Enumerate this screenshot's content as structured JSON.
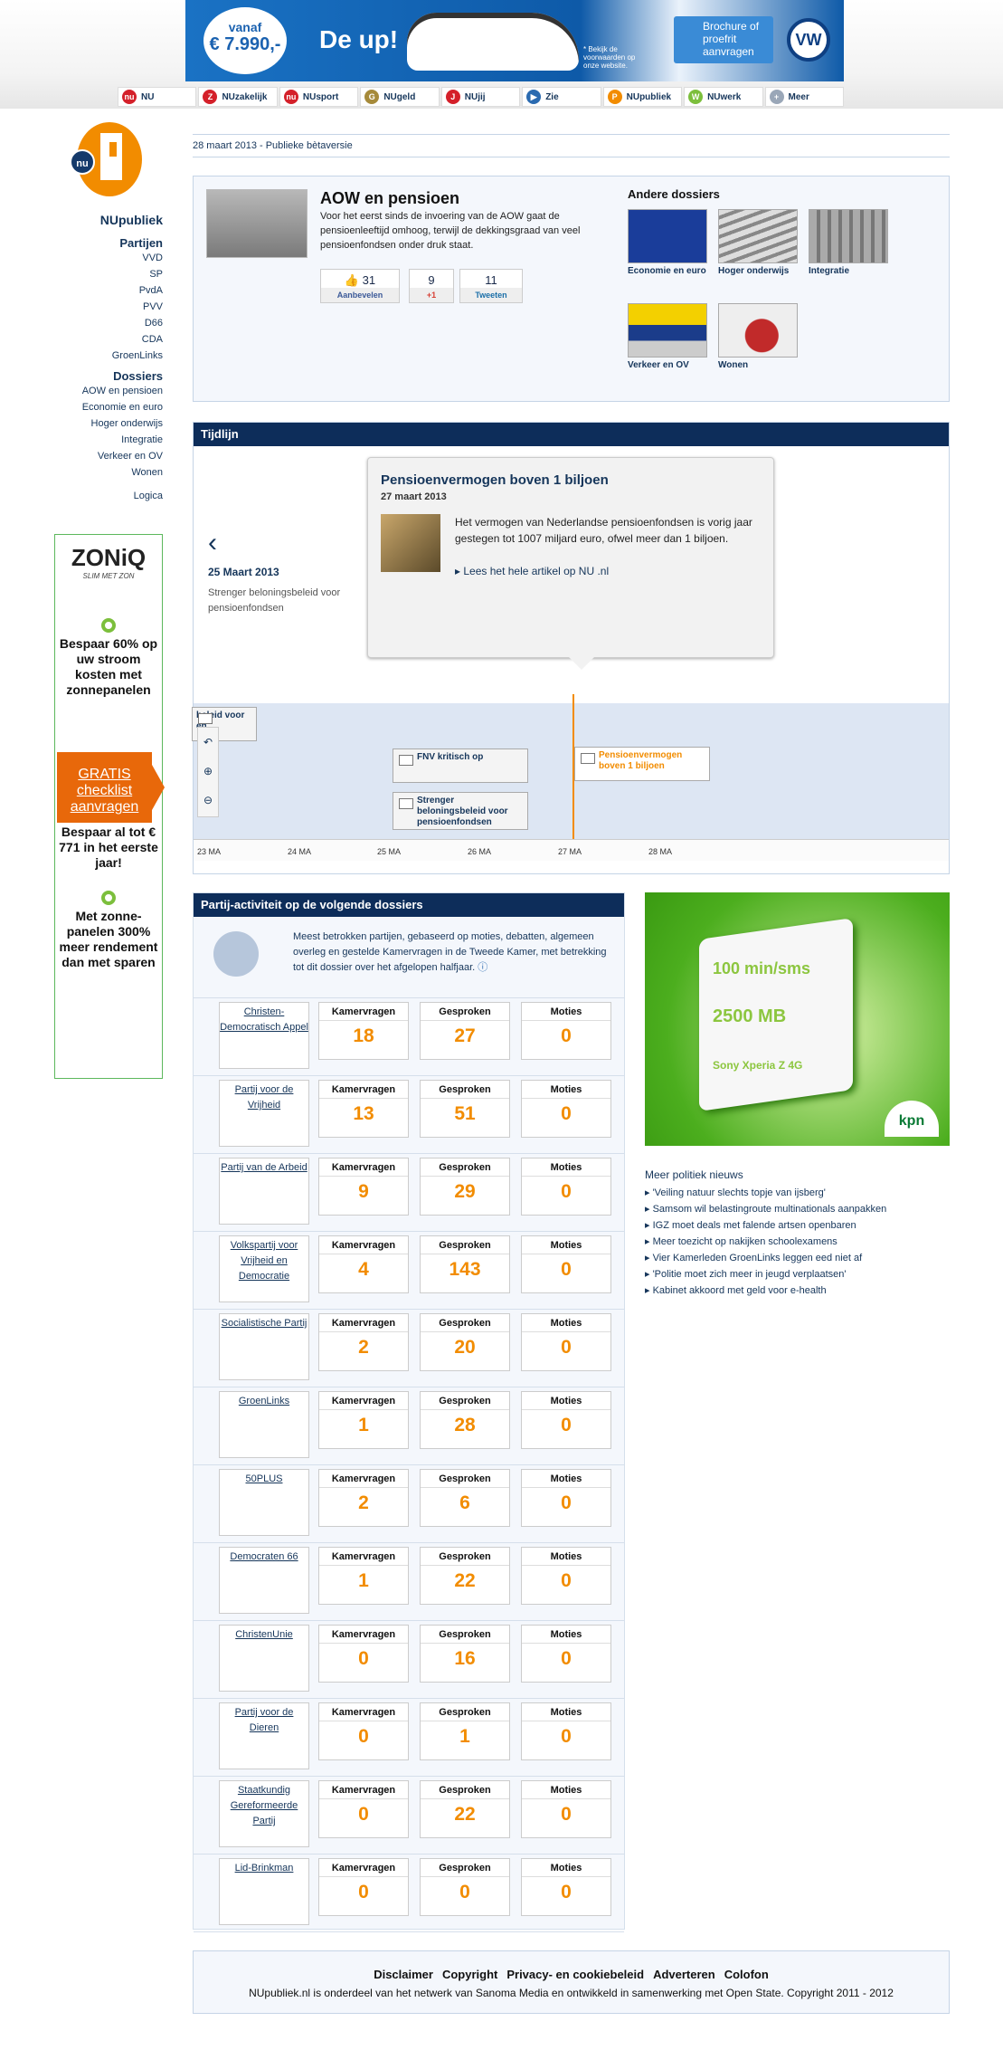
{
  "ad": {
    "price_small": "vanaf",
    "price": "€ 7.990,-",
    "headline": "De up!",
    "small_print": "* Bekijk de voorwaarden op onze website.",
    "cta": "Brochure of proefrit aanvragen",
    "brand": "VW"
  },
  "nav": [
    {
      "label": "NU",
      "color": "#d4202a",
      "icon": "nu"
    },
    {
      "label": "NUzakelijk",
      "color": "#d4202a",
      "icon": "Z"
    },
    {
      "label": "NUsport",
      "color": "#d4202a",
      "icon": "nu"
    },
    {
      "label": "NUgeld",
      "color": "#a68a3a",
      "icon": "G"
    },
    {
      "label": "NUjij",
      "color": "#d4202a",
      "icon": "J"
    },
    {
      "label": "Zie",
      "color": "#2a6ab0",
      "icon": "▶"
    },
    {
      "label": "NUpubliek",
      "color": "#f28c00",
      "icon": "P"
    },
    {
      "label": "NUwerk",
      "color": "#7cbf3c",
      "icon": "W"
    },
    {
      "label": "Meer",
      "color": "#9aa7b8",
      "icon": "+"
    }
  ],
  "sidebar": {
    "site_name": "NUpubliek",
    "logo_nu": "nu",
    "partijen_heading": "Partijen",
    "partijen": [
      "VVD",
      "SP",
      "PvdA",
      "PVV",
      "D66",
      "CDA",
      "GroenLinks"
    ],
    "dossiers_heading": "Dossiers",
    "dossiers": [
      "AOW en pensioen",
      "Economie en euro",
      "Hoger onderwijs",
      "Integratie",
      "Verkeer en OV",
      "Wonen"
    ],
    "logica": "Logica"
  },
  "zon": {
    "logo": "ZONiQ",
    "tagline": "SLIM MET ZON",
    "text1": "Bespaar 60% op uw stroom kosten met zonnepanelen",
    "button": "GRATIS checklist aanvragen",
    "text2": "Bespaar al tot € 771 in het eerste jaar!",
    "text3": "Met zonne-panelen 300% meer rendement dan met sparen"
  },
  "date_line": "28 maart 2013 - Publieke bètaversie",
  "dossier": {
    "title": "AOW en pensioen",
    "description": "Voor het eerst sinds de invoering van de AOW gaat de pensioenleeftijd omhoog, terwijl de dekkingsgraad van veel pensioenfondsen onder druk staat.",
    "likes": "31",
    "like_label": "Aanbevelen",
    "plus": "9",
    "plus_label": "+1",
    "tweets": "11",
    "tweet_label": "Tweeten",
    "other_heading": "Andere dossiers",
    "others": [
      "Economie en euro",
      "Hoger onderwijs",
      "Integratie",
      "Verkeer en OV",
      "Wonen"
    ]
  },
  "timeline": {
    "heading": "Tijdlijn",
    "popup_title": "Pensioenvermogen boven 1 biljoen",
    "popup_date": "27 maart 2013",
    "popup_text": "Het vermogen van Nederlandse pensioenfondsen is vorig jaar gestegen tot 1007 miljard euro, ofwel meer dan 1 biljoen.",
    "popup_link": "Lees het hele artikel op NU .nl",
    "prev_date": "25 Maart 2013",
    "prev_text": "Strenger beloningsbeleid voor pensioenfondsen",
    "events": [
      "beleid voor en",
      "FNV kritisch op",
      "Strenger beloningsbeleid voor pensioenfondsen",
      "Pensioenvermogen boven 1 biljoen"
    ],
    "ticks": [
      "23 MA",
      "24 MA",
      "25 MA",
      "26 MA",
      "27 MA",
      "28 MA"
    ]
  },
  "partij": {
    "heading": "Partij-activiteit op de volgende dossiers",
    "intro": "Meest betrokken partijen, gebaseerd op moties, debatten, algemeen overleg en gestelde Kamervragen in de Tweede Kamer, met betrekking tot dit dossier over het afgelopen halfjaar.",
    "col1": "Kamervragen",
    "col2": "Gesproken",
    "col3": "Moties",
    "rows": [
      {
        "name": "Christen-Democratisch Appel",
        "kv": "18",
        "g": "27",
        "m": "0"
      },
      {
        "name": "Partij voor de Vrijheid",
        "kv": "13",
        "g": "51",
        "m": "0"
      },
      {
        "name": "Partij van de Arbeid",
        "kv": "9",
        "g": "29",
        "m": "0"
      },
      {
        "name": "Volkspartij voor Vrijheid en Democratie",
        "kv": "4",
        "g": "143",
        "m": "0"
      },
      {
        "name": "Socialistische Partij",
        "kv": "2",
        "g": "20",
        "m": "0"
      },
      {
        "name": "GroenLinks",
        "kv": "1",
        "g": "28",
        "m": "0"
      },
      {
        "name": "50PLUS",
        "kv": "2",
        "g": "6",
        "m": "0"
      },
      {
        "name": "Democraten 66",
        "kv": "1",
        "g": "22",
        "m": "0"
      },
      {
        "name": "ChristenUnie",
        "kv": "0",
        "g": "16",
        "m": "0"
      },
      {
        "name": "Partij voor de Dieren",
        "kv": "0",
        "g": "1",
        "m": "0"
      },
      {
        "name": "Staatkundig Gereformeerde Partij",
        "kv": "0",
        "g": "22",
        "m": "0"
      },
      {
        "name": "Lid-Brinkman",
        "kv": "0",
        "g": "0",
        "m": "0"
      }
    ]
  },
  "kpn": {
    "line1": "100 min/sms",
    "line2": "2500 MB",
    "line3": "Sony Xperia Z 4G",
    "logo": "kpn"
  },
  "news": {
    "heading": "Meer politiek nieuws",
    "items": [
      "'Veiling natuur slechts topje van ijsberg'",
      "Samsom wil belastingroute multinationals aanpakken",
      "IGZ moet deals met falende artsen openbaren",
      "Meer toezicht op nakijken schoolexamens",
      "Vier Kamerleden GroenLinks leggen eed niet af",
      "'Politie moet zich meer in jeugd verplaatsen'",
      "Kabinet akkoord met geld voor e-health"
    ]
  },
  "footer": {
    "links": [
      "Disclaimer",
      "Copyright",
      "Privacy- en cookiebeleid",
      "Adverteren",
      "Colofon"
    ],
    "copy": "NUpubliek.nl is onderdeel van het netwerk van Sanoma Media en ontwikkeld in samenwerking met Open State. Copyright 2011 - 2012"
  }
}
